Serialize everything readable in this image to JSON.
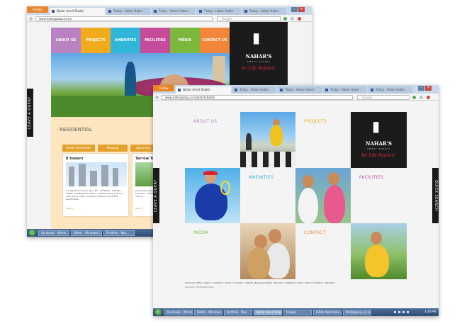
{
  "back_window": {
    "tabs": [
      {
        "label": "Nahar Amrit Shakti",
        "active": true
      },
      {
        "label": "Tkoby - Haber Haber",
        "active": false
      },
      {
        "label": "Tkoby - Haber Haber",
        "active": false
      },
      {
        "label": "Tkoby - Haber Haber",
        "active": false
      },
      {
        "label": "Tkoby - Haber Haber",
        "active": false
      }
    ],
    "app_button": "Firefox",
    "url": "www.nahargroup.co.in/",
    "search_placeholder": "Google",
    "menu": [
      {
        "label": "ABOUT US",
        "color": "#b983c3"
      },
      {
        "label": "PROJECTS",
        "color": "#f1ab1d"
      },
      {
        "label": "AMENITIES",
        "color": "#2fb6d9"
      },
      {
        "label": "FACILITIES",
        "color": "#c64b9b"
      },
      {
        "label": "MEDIA",
        "color": "#7cb83e"
      },
      {
        "label": "CONTACT US",
        "color": "#f1863a"
      }
    ],
    "logo": {
      "brand": "NAHAR'S",
      "sub": "AMRIT SHAKTI",
      "tagline": "let Life Rejoice!"
    },
    "side_tab": "LEAVE A QUERY",
    "section_title": "RESIDENTIAL",
    "pills": [
      "Ready Possession",
      "Ongoing",
      "Upcoming"
    ],
    "cards": [
      {
        "title": "8 towers",
        "text": "8 magnificent towers (B1 - B5 - ASTRALIS - PAVONA - ARUM - ALAMANDA & TULIA - TULIPA having 23 floors each and is under completion offering 2 & 3 BHK apartments.",
        "more": "More >"
      },
      {
        "title": "Tarrow Tocc",
        "text": "The perfect place ... pleasant ... afresh and vibrant ...",
        "more": "More >"
      }
    ],
    "taskbar": [
      "Facebook - Windo...",
      "Billets - Windows L...",
      "Portfolio - Nas..."
    ]
  },
  "front_window": {
    "tabs": [
      {
        "label": "Nahar Amrit Shakti",
        "active": true
      },
      {
        "label": "Tkoby - Haber Haber",
        "active": false
      },
      {
        "label": "Tkoby - Haber Haber",
        "active": false
      },
      {
        "label": "Tkoby - Haber Haber",
        "active": false
      },
      {
        "label": "Tkoby - Haber Haber",
        "active": false
      }
    ],
    "app_button": "Firefox",
    "url": "www.nahargroup.co.in/amritshakti/",
    "search_placeholder": "Google",
    "grid_labels": {
      "about": "ABOUT US",
      "projects": "PROJECTS",
      "amenities": "AMENITIES",
      "facilities": "FACILITIES",
      "media": "MEDIA",
      "contact": "CONTACT"
    },
    "label_colors": {
      "about": "#b983c3",
      "projects": "#f1ab1d",
      "amenities": "#2fb6d9",
      "facilities": "#c64b9b",
      "media": "#7cb83e",
      "contact": "#f1863a"
    },
    "logo": {
      "brand": "NAHAR'S",
      "sub": "AMRIT SHAKTI",
      "tagline": "let Life Rejoice!"
    },
    "left_tab": "LEAVE A QUERY",
    "right_tab": "QUICK SEARCH",
    "footer": {
      "quick_links": "Quick Links: Office Locations  •  Feedback  •  Awards & Accolades  •  Sitemap  |  Businesses: Realty  •  Education  •  Healthcare  •  Retail  •  Terms & Conditions  •  Disclaimer",
      "copyright": "Copyright © 2015 Nahar Group"
    },
    "taskbar": [
      "Facebook - Windo...",
      "Billets - Windows L...",
      "Portfolio - Nas...",
      "Nahar Amrit Shakti...",
      "Images",
      "Billets Nommées...",
      "Nahargroup.co.in..."
    ],
    "clock": "3:26 PM"
  }
}
